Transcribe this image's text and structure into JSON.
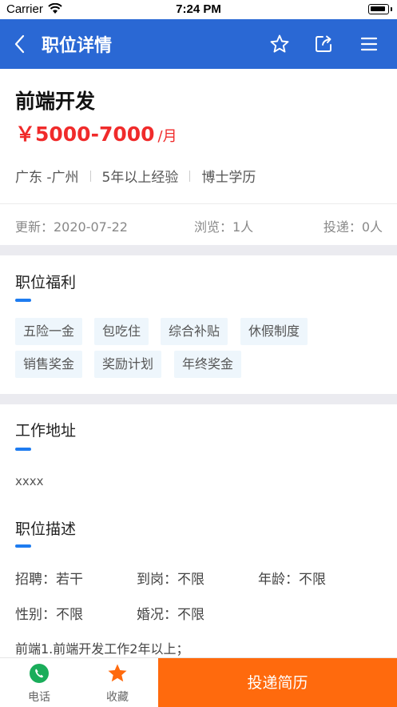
{
  "status_bar": {
    "carrier": "Carrier",
    "time": "7:24 PM"
  },
  "nav": {
    "title": "职位详情",
    "icons": [
      "back-icon",
      "star-icon",
      "share-icon",
      "menu-icon"
    ]
  },
  "job": {
    "title": "前端开发",
    "salary": "￥5000-7000",
    "salary_unit": "/月",
    "location": "广东 -广州",
    "experience": "5年以上经验",
    "education": "博士学历",
    "updated": "更新：2020-07-22",
    "views": "浏览：1人",
    "applied": "投递：0人"
  },
  "benefits": {
    "title": "职位福利",
    "tags": [
      "五险一金",
      "包吃住",
      "综合补贴",
      "休假制度",
      "销售奖金",
      "奖励计划",
      "年终奖金"
    ]
  },
  "address": {
    "title": "工作地址",
    "value": "xxxx"
  },
  "description": {
    "title": "职位描述",
    "recruit": "招聘：若干",
    "onboard": "到岗：不限",
    "age": "年龄：不限",
    "gender": "性别：不限",
    "marital": "婚况：不限",
    "text": "前端1.前端开发工作2年以上；"
  },
  "bottom_bar": {
    "phone_label": "电话",
    "favorite_label": "收藏",
    "apply_label": "投递简历"
  },
  "colors": {
    "nav_bg": "#2a68d4",
    "salary": "#f02b2b",
    "accent": "#1e7cf0",
    "apply_bg": "#ff6a0d",
    "phone_icon": "#1aad5a",
    "favorite_icon": "#ff6a0d"
  }
}
